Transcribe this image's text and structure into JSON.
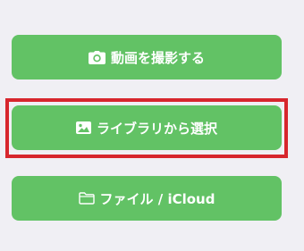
{
  "buttons": {
    "camera": {
      "label": "動画を撮影する",
      "icon": "camera-icon"
    },
    "library": {
      "label": "ライブラリから選択",
      "icon": "photo-icon"
    },
    "files": {
      "label": "ファイル / iCloud",
      "icon": "folder-icon"
    }
  },
  "colors": {
    "background": "#f0eff4",
    "button": "#62c265",
    "button_text": "#ffffff",
    "highlight": "#d7262d"
  },
  "highlighted": "library"
}
